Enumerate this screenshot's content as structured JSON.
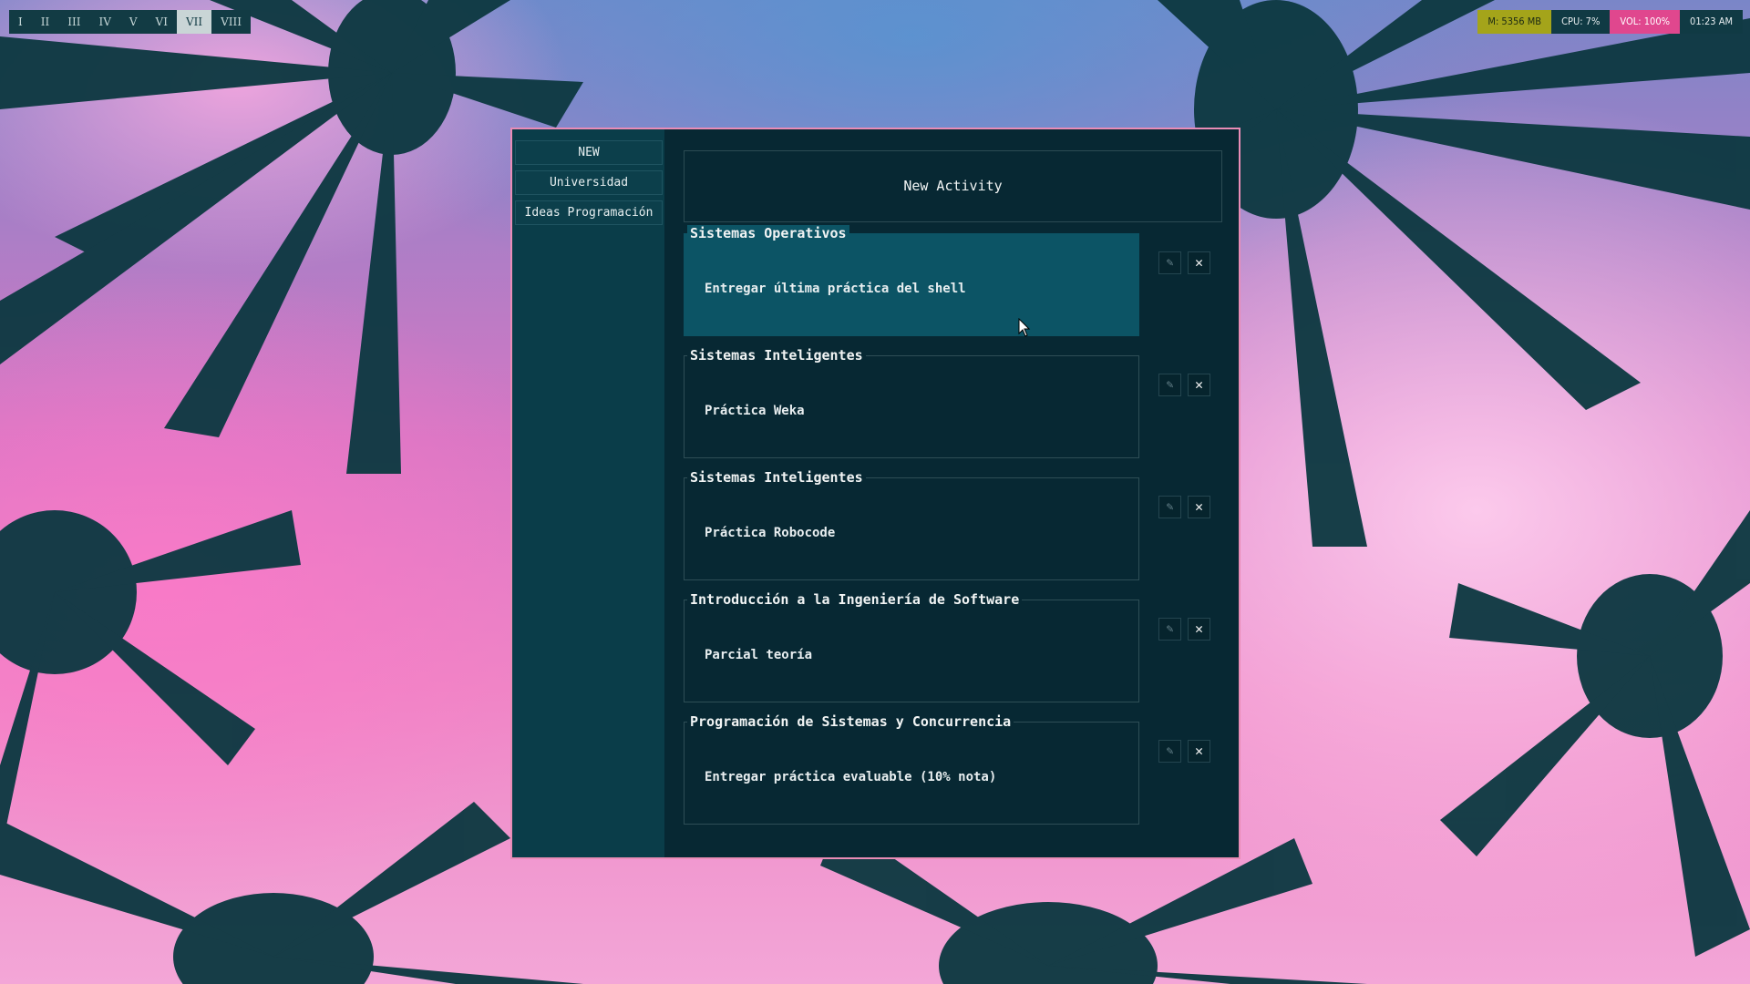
{
  "workspaces": [
    {
      "label": "I",
      "active": false
    },
    {
      "label": "II",
      "active": false
    },
    {
      "label": "III",
      "active": false
    },
    {
      "label": "IV",
      "active": false
    },
    {
      "label": "V",
      "active": false
    },
    {
      "label": "VI",
      "active": false
    },
    {
      "label": "VII",
      "active": true
    },
    {
      "label": "VIII",
      "active": false
    }
  ],
  "status": {
    "memory": "M: 5356 MB",
    "cpu": "CPU: 7%",
    "volume": "VOL: 100%",
    "clock": "01:23 AM"
  },
  "sidebar": {
    "items": [
      {
        "label": "NEW"
      },
      {
        "label": "Universidad"
      },
      {
        "label": "Ideas Programación"
      }
    ]
  },
  "main": {
    "new_activity_label": "New Activity",
    "activities": [
      {
        "subject": "Sistemas Operativos",
        "task": "Entregar última práctica del shell",
        "highlighted": true
      },
      {
        "subject": "Sistemas Inteligentes",
        "task": "Práctica Weka",
        "highlighted": false
      },
      {
        "subject": "Sistemas Inteligentes",
        "task": "Práctica Robocode",
        "highlighted": false
      },
      {
        "subject": "Introducción a la Ingeniería de Software",
        "task": "Parcial teoría",
        "highlighted": false
      },
      {
        "subject": "Programación de Sistemas y Concurrencia",
        "task": "Entregar práctica evaluable (10% nota)",
        "highlighted": false
      }
    ],
    "edit_icon": "pencil-icon",
    "delete_icon": "close-icon",
    "edit_glyph": "✎",
    "delete_glyph": "✕"
  },
  "colors": {
    "window_bg": "#072833",
    "sidebar_bg": "#0a3d49",
    "highlight": "#0c5465",
    "window_border": "#e98cb6",
    "mem_badge": "#a4a41a",
    "vol_badge": "#e0478e"
  }
}
